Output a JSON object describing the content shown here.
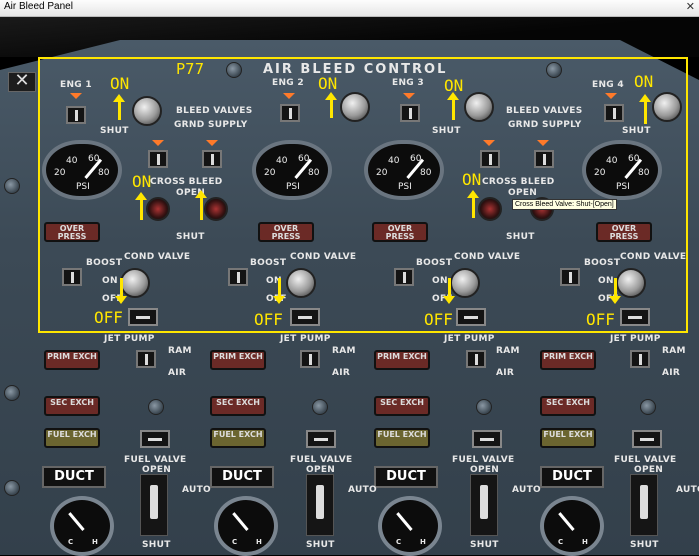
{
  "window": {
    "title": "Air Bleed Panel",
    "close": "✕"
  },
  "panel": {
    "title": "AIR BLEED CONTROL",
    "page_label": "P77",
    "bleed_valves": "BLEED VALVES",
    "grnd_supply": "GRND SUPPLY",
    "cross_bleed": "CROSS BLEED",
    "open": "OPEN",
    "shut": "SHUT",
    "psi": "PSI",
    "gauge_ticks": [
      "20",
      "40",
      "60",
      "80"
    ],
    "over_press": "OVER PRESS",
    "cond_valve": "COND VALVE",
    "boost": "BOOST",
    "on": "ON",
    "off": "OFF",
    "jet_pump": "JET PUMP",
    "ram": "RAM",
    "air": "AIR",
    "prim_exch": "PRIM EXCH",
    "sec_exch": "SEC EXCH",
    "fuel_exch": "FUEL EXCH",
    "fuel_valve": "FUEL VALVE",
    "duct": "DUCT",
    "auto": "AUTO",
    "dial_c": "C",
    "dial_h": "H"
  },
  "engines": [
    {
      "label": "ENG 1"
    },
    {
      "label": "ENG 2"
    },
    {
      "label": "ENG 3"
    },
    {
      "label": "ENG 4"
    }
  ],
  "annotations": {
    "on": "ON",
    "off": "OFF"
  },
  "tooltip": "Cross Bleed Valve: Shut-[Open]",
  "colors": {
    "annotation": "#ffe600",
    "panel": "#3c4a56"
  }
}
